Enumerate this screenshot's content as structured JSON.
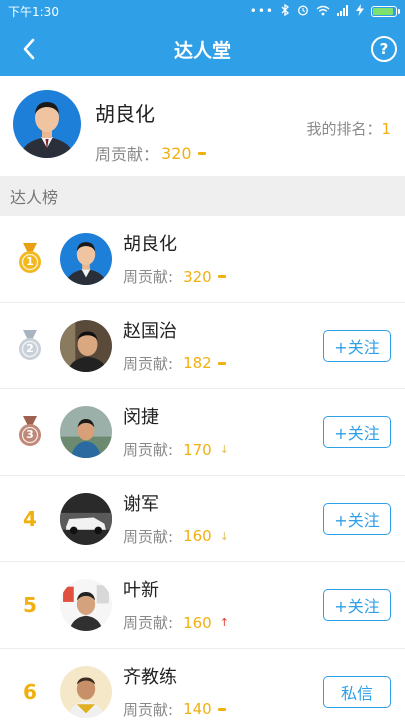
{
  "status_bar": {
    "time": "下午1:30",
    "icons": [
      "signal-dots-icon",
      "bluetooth-icon",
      "alarm-icon",
      "wifi-icon",
      "cell-signal-icon",
      "charging-icon",
      "battery-icon"
    ],
    "battery_fill": 0.9
  },
  "header": {
    "title": "达人堂",
    "back_icon": "back-arrow-icon",
    "help_label": "?"
  },
  "me": {
    "name": "胡良化",
    "contrib_label": "周贡献：",
    "contrib_value": "320",
    "rank_label": "我的排名：",
    "rank_value": "1"
  },
  "section_title": "达人榜",
  "colors": {
    "primary": "#2f9fe8",
    "accent": "#f0b010",
    "up": "#e03a30"
  },
  "leaderboard": [
    {
      "rank": "1",
      "badge": "gold-medal-icon",
      "name": "胡良化",
      "contrib_label": "周贡献:",
      "value": "320",
      "trend": "flat",
      "action": ""
    },
    {
      "rank": "2",
      "badge": "silver-medal-icon",
      "name": "赵国治",
      "contrib_label": "周贡献:",
      "value": "182",
      "trend": "flat",
      "action": "+关注"
    },
    {
      "rank": "3",
      "badge": "bronze-medal-icon",
      "name": "闵捷",
      "contrib_label": "周贡献:",
      "value": "170",
      "trend": "down",
      "action": "+关注"
    },
    {
      "rank": "4",
      "badge": "",
      "name": "谢军",
      "contrib_label": "周贡献:",
      "value": "160",
      "trend": "down",
      "action": "+关注"
    },
    {
      "rank": "5",
      "badge": "",
      "name": "叶新",
      "contrib_label": "周贡献:",
      "value": "160",
      "trend": "up",
      "action": "+关注"
    },
    {
      "rank": "6",
      "badge": "",
      "name": "齐教练",
      "contrib_label": "周贡献:",
      "value": "140",
      "trend": "flat",
      "action": "私信"
    }
  ]
}
